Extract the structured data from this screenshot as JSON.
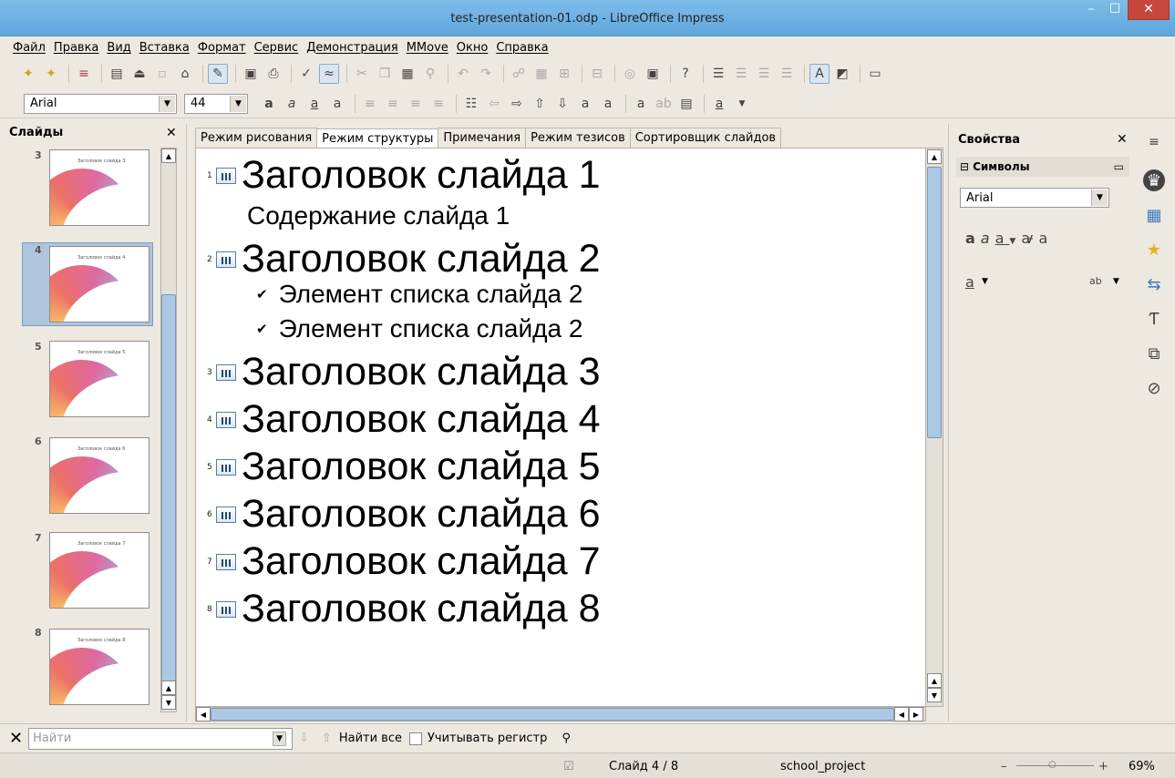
{
  "window": {
    "title": "test-presentation-01.odp - LibreOffice Impress",
    "min": "–",
    "max": "☐",
    "close": "✕"
  },
  "menu": [
    "Файл",
    "Правка",
    "Вид",
    "Вставка",
    "Формат",
    "Сервис",
    "Демонстрация",
    "MMove",
    "Окно",
    "Справка"
  ],
  "formatting": {
    "font_name": "Arial",
    "font_size": "44"
  },
  "slides_pane": {
    "title": "Слайды",
    "close": "✕",
    "selected": 4,
    "thumbnails": [
      {
        "number": "3",
        "caption": "Заголовок слайда 3"
      },
      {
        "number": "4",
        "caption": "Заголовок слайда 4"
      },
      {
        "number": "5",
        "caption": "Заголовок слайда 5"
      },
      {
        "number": "6",
        "caption": "Заголовок слайда 6"
      },
      {
        "number": "7",
        "caption": "Заголовок слайда 7"
      },
      {
        "number": "8",
        "caption": "Заголовок слайда 8"
      }
    ]
  },
  "view_tabs": [
    "Режим рисования",
    "Режим структуры",
    "Примечания",
    "Режим тезисов",
    "Сортировщик слайдов"
  ],
  "active_tab": "Режим структуры",
  "outline": [
    {
      "num": "1",
      "title": "Заголовок слайда 1"
    },
    {
      "body": "Содержание слайда 1"
    },
    {
      "num": "2",
      "title": "Заголовок слайда 2"
    },
    {
      "bullet": "✔",
      "item": "Элемент списка слайда 2"
    },
    {
      "bullet": "✔",
      "item": "Элемент списка слайда 2"
    },
    {
      "num": "3",
      "title": "Заголовок слайда 3"
    },
    {
      "num": "4",
      "title": "Заголовок слайда 4"
    },
    {
      "num": "5",
      "title": "Заголовок слайда 5"
    },
    {
      "num": "6",
      "title": "Заголовок слайда 6"
    },
    {
      "num": "7",
      "title": "Заголовок слайда 7"
    },
    {
      "num": "8",
      "title": "Заголовок слайда 8"
    }
  ],
  "sidebar": {
    "title": "Свойства",
    "close": "✕",
    "section": "Символы",
    "font_name": "Arial"
  },
  "findbar": {
    "placeholder": "Найти",
    "find_all": "Найти все",
    "match_case": "Учитывать регистр"
  },
  "statusbar": {
    "slide": "Слайд 4 / 8",
    "master": "school_project",
    "zoom": "69%"
  }
}
